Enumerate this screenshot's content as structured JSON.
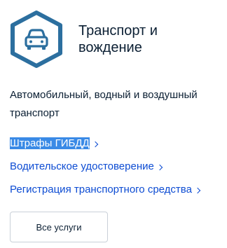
{
  "category": {
    "title": "Транспорт и вождение",
    "icon": "car-front-icon",
    "icon_color": "#2c6f9f",
    "description": "Автомобильный, водный и воздушный транспорт"
  },
  "links": [
    {
      "label": "Штрафы ГИБДД",
      "selected": true
    },
    {
      "label": "Водительское удостоверение",
      "selected": false
    },
    {
      "label": "Регистрация транспортного средства",
      "selected": false
    }
  ],
  "all_services_button": "Все услуги",
  "colors": {
    "link": "#0d4cd3",
    "text": "#0b1f33",
    "selection": "#3a8ae6"
  }
}
